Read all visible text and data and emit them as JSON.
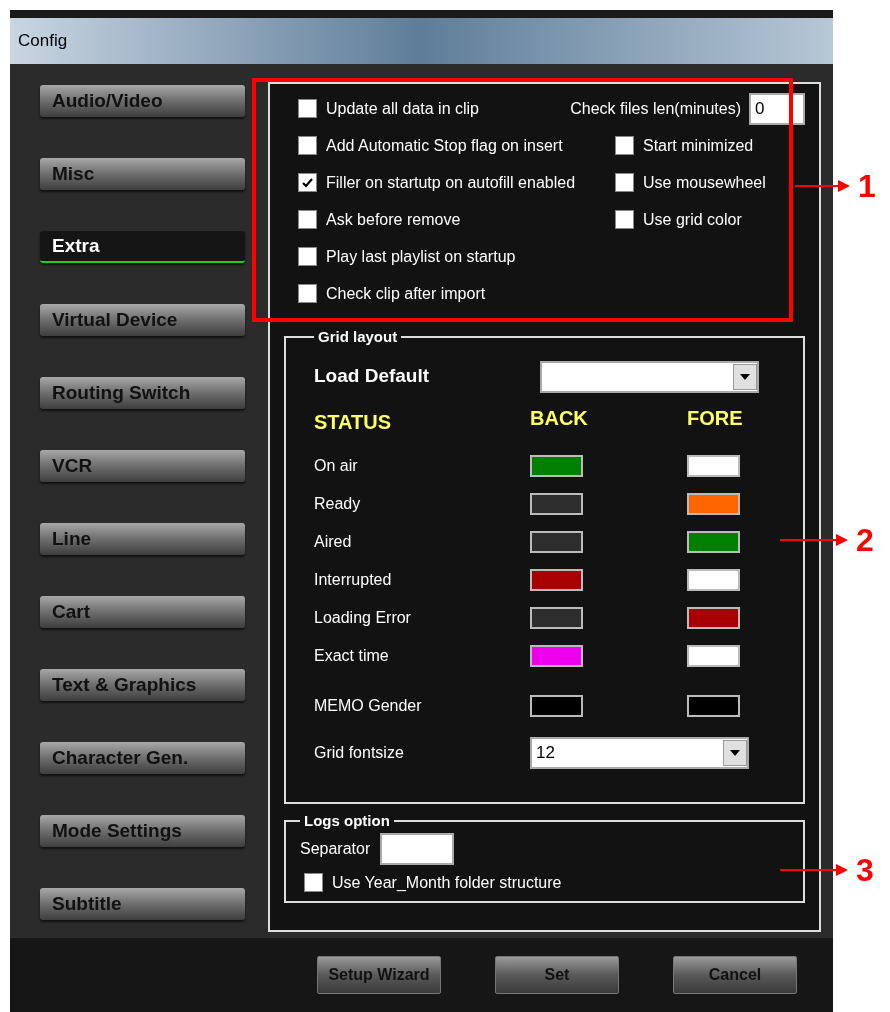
{
  "window": {
    "title": "Config"
  },
  "sidebar": {
    "items": [
      {
        "label": "Audio/Video",
        "selected": false
      },
      {
        "label": "Misc",
        "selected": false
      },
      {
        "label": "Extra",
        "selected": true
      },
      {
        "label": "Virtual Device",
        "selected": false
      },
      {
        "label": "Routing Switch",
        "selected": false
      },
      {
        "label": "VCR",
        "selected": false
      },
      {
        "label": "Line",
        "selected": false
      },
      {
        "label": "Cart",
        "selected": false
      },
      {
        "label": "Text & Graphics",
        "selected": false
      },
      {
        "label": "Character Gen.",
        "selected": false
      },
      {
        "label": "Mode Settings",
        "selected": false
      },
      {
        "label": "Subtitle",
        "selected": false
      }
    ]
  },
  "options": {
    "left": [
      {
        "label": "Update all data in clip",
        "checked": false
      },
      {
        "label": "Add Automatic Stop flag on insert",
        "checked": false
      },
      {
        "label": "Filler on startutp on autofill enabled",
        "checked": true
      },
      {
        "label": "Ask before remove",
        "checked": false
      },
      {
        "label": "Play last playlist on startup",
        "checked": false
      },
      {
        "label": "Check clip after import",
        "checked": false
      }
    ],
    "right": [
      {
        "kind": "field",
        "label": "Check files len(minutes)",
        "value": "0"
      },
      {
        "kind": "checkbox",
        "label": "Start minimized",
        "checked": false
      },
      {
        "kind": "checkbox",
        "label": "Use mousewheel",
        "checked": false
      },
      {
        "kind": "checkbox",
        "label": "Use grid color",
        "checked": false
      }
    ]
  },
  "grid_layout": {
    "title": "Grid layout",
    "load_default": {
      "label": "Load Default"
    },
    "headers": {
      "status": "STATUS",
      "back": "BACK",
      "fore": "FORE"
    },
    "rows": [
      {
        "label": "On air",
        "back": {
          "color": "#008000"
        },
        "fore": {
          "color": "#ffffff"
        }
      },
      {
        "label": "Ready",
        "back": {
          "color": "#2d2d2d"
        },
        "fore": {
          "color": "#ff6600"
        }
      },
      {
        "label": "Aired",
        "back": {
          "color": "#2d2d2d"
        },
        "fore": {
          "color": "#008000"
        }
      },
      {
        "label": "Interrupted",
        "back": {
          "color": "#a80000"
        },
        "fore": {
          "color": "#ffffff"
        }
      },
      {
        "label": "Loading Error",
        "back": {
          "color": "#2d2d2d"
        },
        "fore": {
          "color": "#a80000"
        }
      },
      {
        "label": "Exact time",
        "back": {
          "color": "#ee00ee"
        },
        "fore": {
          "color": "#ffffff"
        }
      },
      {
        "label": "MEMO Gender",
        "back": {
          "color": "#000000"
        },
        "fore": {
          "color": "#000000"
        }
      }
    ],
    "font_size": {
      "label": "Grid fontsize",
      "value": "12"
    }
  },
  "logs_option": {
    "title": "Logs option",
    "separator_label": "Separator",
    "checkbox": {
      "label": "Use Year_Month folder structure",
      "checked": false
    }
  },
  "buttons": [
    "Setup Wizard",
    "Set",
    "Cancel"
  ],
  "callouts": [
    {
      "label": "1"
    },
    {
      "label": "2"
    },
    {
      "label": "3"
    }
  ]
}
